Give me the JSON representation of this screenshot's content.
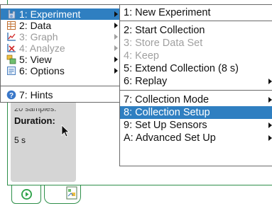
{
  "meter": {
    "samples_text": "20 samples.",
    "duration_label": "Duration:",
    "duration_value": "5 s"
  },
  "main_menu": {
    "items": [
      {
        "label": "1: Experiment",
        "icon": "experiment-icon",
        "state": "selected"
      },
      {
        "label": "2: Data",
        "icon": "data-table-icon",
        "state": "enabled"
      },
      {
        "label": "3: Graph",
        "icon": "graph-icon",
        "state": "disabled"
      },
      {
        "label": "4: Analyze",
        "icon": "analyze-icon",
        "state": "disabled"
      },
      {
        "label": "5: View",
        "icon": "view-icon",
        "state": "enabled"
      },
      {
        "label": "6: Options",
        "icon": "options-icon",
        "state": "enabled"
      },
      {
        "label": "7: Hints",
        "icon": "hints-icon",
        "state": "enabled"
      }
    ]
  },
  "sub_menu": {
    "items": [
      {
        "label": "1: New Experiment",
        "state": "enabled"
      },
      {
        "label": "2: Start Collection",
        "state": "enabled"
      },
      {
        "label": "3: Store Data Set",
        "state": "disabled"
      },
      {
        "label": "4: Keep",
        "state": "disabled"
      },
      {
        "label": "5: Extend Collection (8 s)",
        "state": "enabled"
      },
      {
        "label": "6: Replay",
        "state": "enabled"
      },
      {
        "label": "7: Collection Mode",
        "state": "enabled"
      },
      {
        "label": "8: Collection Setup",
        "state": "selected"
      },
      {
        "label": "9: Set Up Sensors",
        "state": "enabled"
      },
      {
        "label": "A: Advanced Set Up",
        "state": "enabled"
      }
    ]
  },
  "tabs": [
    {
      "icon": "play-icon"
    },
    {
      "icon": "page-icon"
    }
  ],
  "colors": {
    "selection": "#2f7fc1",
    "frame_green": "#2e8f4a",
    "disabled_text": "#9a9a9a"
  }
}
